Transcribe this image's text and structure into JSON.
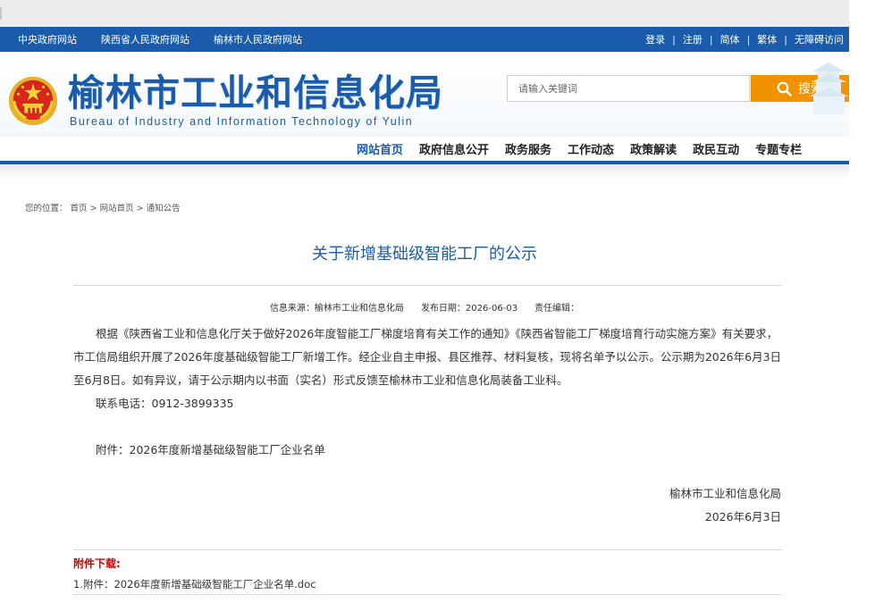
{
  "topbar": {
    "left_links": [
      "中央政府网站",
      "陕西省人民政府网站",
      "榆林市人民政府网站"
    ],
    "right_links": [
      "登录",
      "注册",
      "简体",
      "繁体",
      "无障碍访问"
    ],
    "separator": "|"
  },
  "header": {
    "title": "榆林市工业和信息化局",
    "subtitle": "Bureau of Industry and Information Technology of Yulin",
    "search_placeholder": "请输入关键词",
    "search_button": "搜索"
  },
  "nav": {
    "items": [
      "网站首页",
      "政府信息公开",
      "政务服务",
      "工作动态",
      "政策解读",
      "政民互动",
      "专题专栏"
    ],
    "active_index": 0
  },
  "breadcrumb": {
    "label": "您的位置：",
    "items": [
      "首页",
      "网站首页",
      "通知公告"
    ],
    "separator": ">"
  },
  "article": {
    "title": "关于新增基础级智能工厂的公示",
    "meta": {
      "source": "信息来源：榆林市工业和信息化局",
      "date": "发布日期：2026-06-03",
      "editor": "责任编辑："
    },
    "paragraph": "根据《陕西省工业和信息化厅关于做好2026年度智能工厂梯度培育有关工作的通知》《陕西省智能工厂梯度培育行动实施方案》有关要求，市工信局组织开展了2026年度基础级智能工厂新增工作。经企业自主申报、县区推荐、材料复核，现将名单予以公示。公示期为2026年6月3日至6月8日。如有异议，请于公示期内以书面（实名）形式反馈至榆林市工业和信息化局装备工业科。",
    "contact": "联系电话：0912-3899335",
    "attachment": "附件：2026年度新增基础级智能工厂企业名单",
    "sign_org": "榆林市工业和信息化局",
    "sign_date": "2026年6月3日"
  },
  "downloads": {
    "label": "附件下载:",
    "items": [
      "1.附件：2026年度新增基础级智能工厂企业名单.doc"
    ]
  },
  "colors": {
    "brand_blue": "#1a5cab",
    "search_orange": "#f39200",
    "download_red": "#d40000"
  },
  "icons": {
    "emblem": "national-emblem-icon",
    "search": "search-icon"
  }
}
